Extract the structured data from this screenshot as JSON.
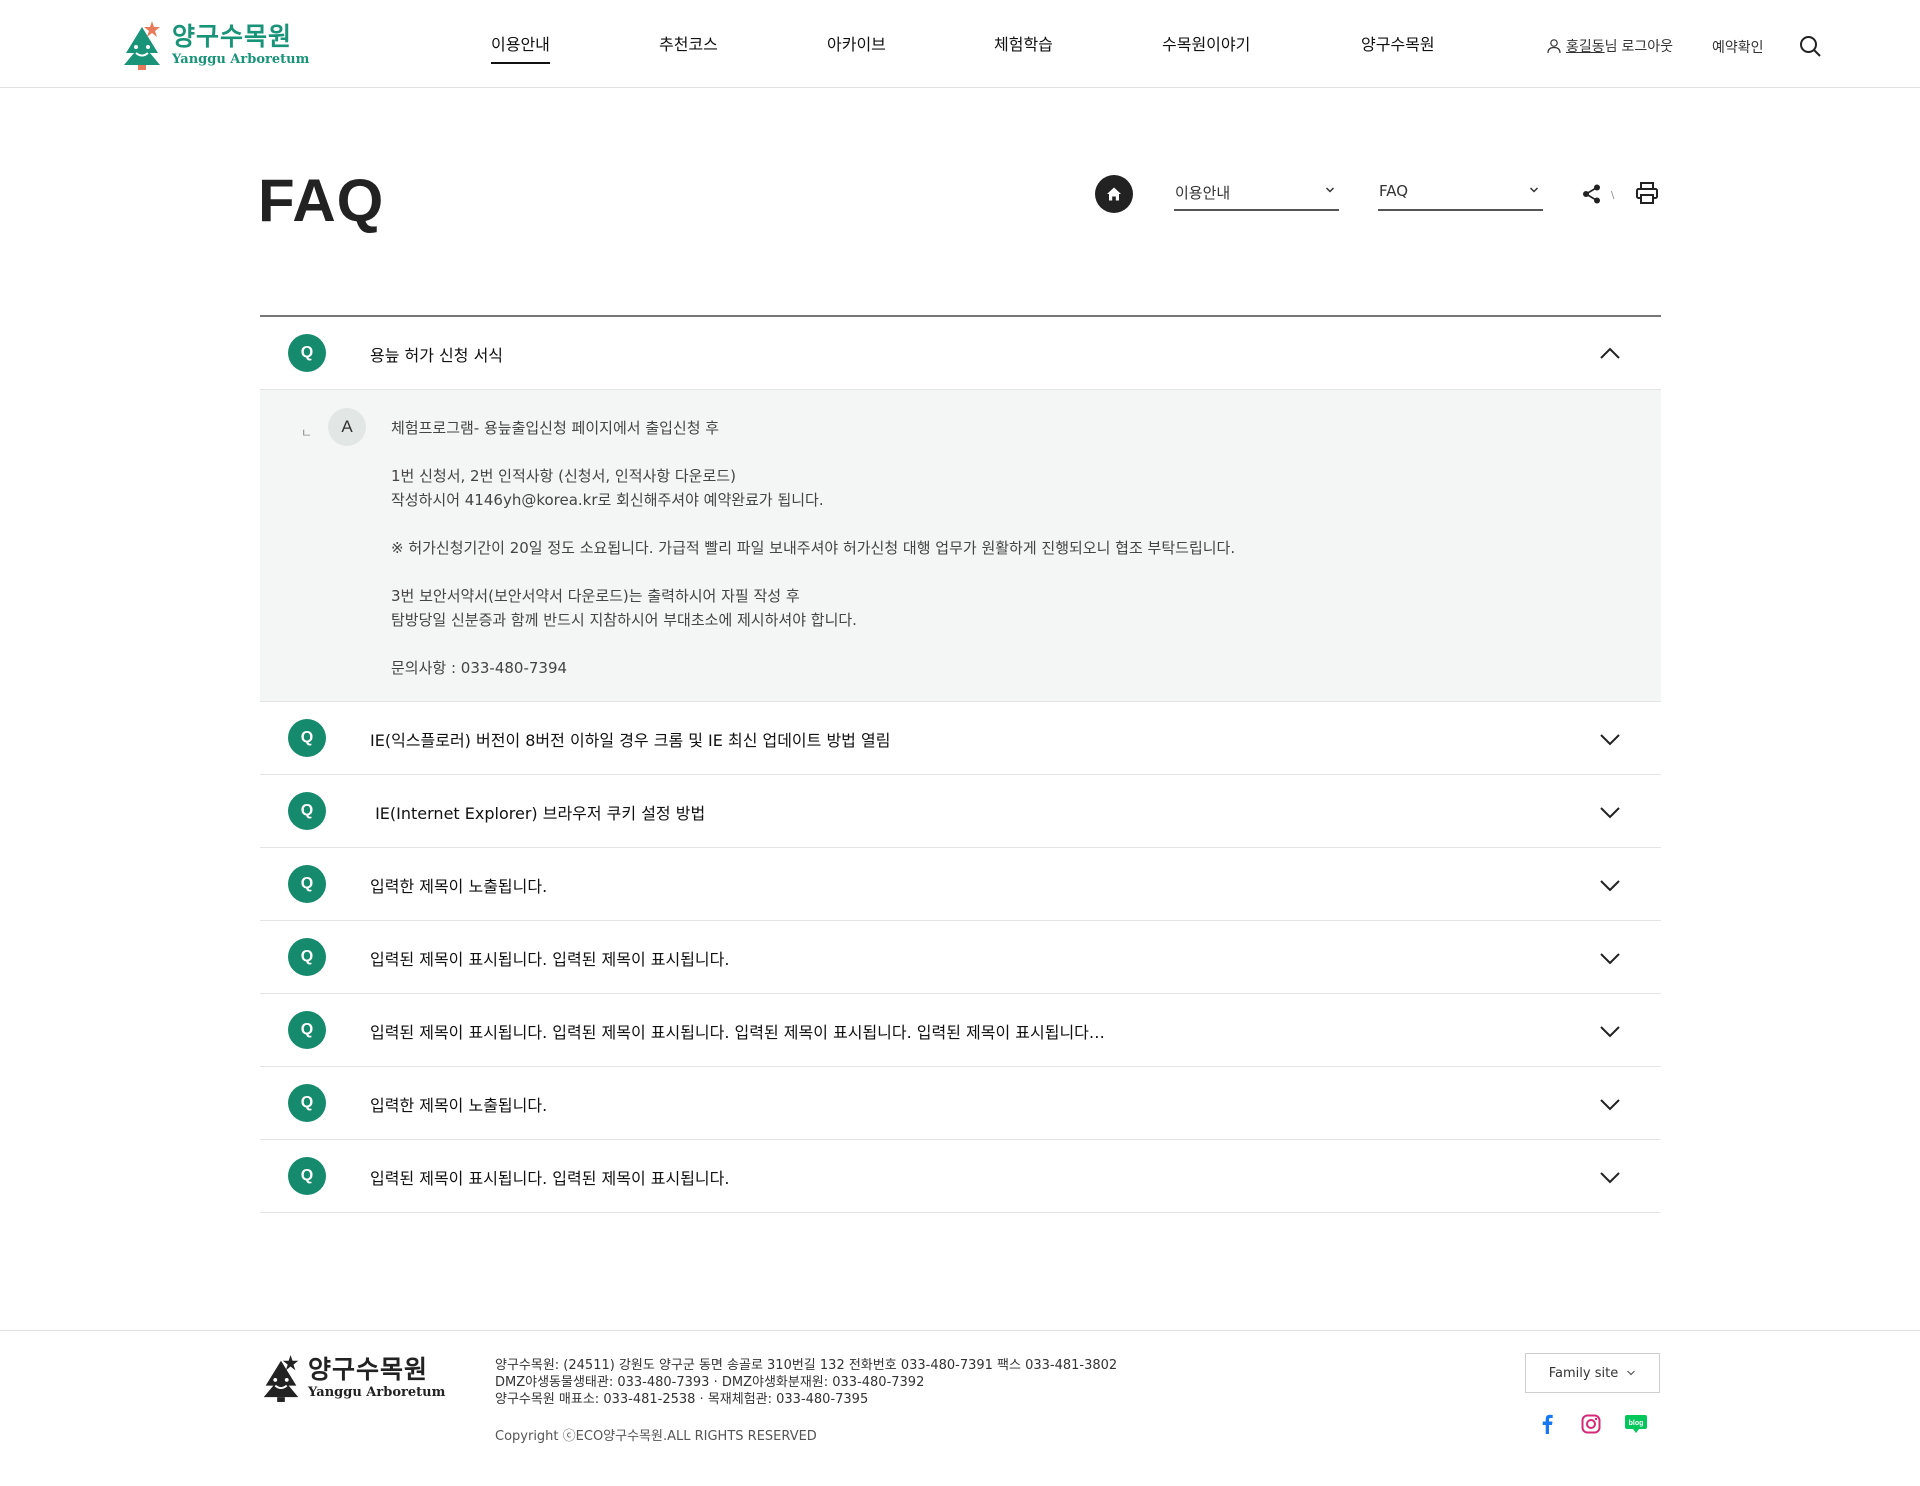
{
  "header": {
    "logo": {
      "ko": "양구수목원",
      "en": "Yanggu Arboretum"
    },
    "nav": [
      {
        "label": "이용안내",
        "active": true
      },
      {
        "label": "추천코스",
        "active": false
      },
      {
        "label": "아카이브",
        "active": false
      },
      {
        "label": "체험학습",
        "active": false
      },
      {
        "label": "수목원이야기",
        "active": false
      },
      {
        "label": "양구수목원",
        "active": false
      }
    ],
    "user": {
      "name": "홍길동",
      "suffix": "님",
      "logout": "로그아웃"
    },
    "reserve_label": "예약확인",
    "search_icon": "search-icon"
  },
  "page": {
    "title": "FAQ",
    "breadcrumb": {
      "home_icon": "home-icon",
      "depth1": "이용안내",
      "depth2": "FAQ"
    },
    "tools": {
      "share_icon": "share-icon",
      "separator": "\\",
      "print_icon": "print-icon"
    }
  },
  "faq": {
    "q_badge": "Q",
    "a_badge": "A",
    "answer_marker": "ㄴ",
    "items": [
      {
        "question": "용늪 허가 신청 서식",
        "expanded": true
      },
      {
        "question": "IE(익스플로러) 버전이 8버전 이하일 경우 크롬 및 IE 최신 업데이트 방법 열림",
        "expanded": false
      },
      {
        "question": " IE(Internet Explorer) 브라우저 쿠키 설정 방법",
        "expanded": false
      },
      {
        "question": "입력한 제목이 노출됩니다.",
        "expanded": false
      },
      {
        "question": "입력된 제목이 표시됩니다. 입력된 제목이 표시됩니다.",
        "expanded": false
      },
      {
        "question": "입력된 제목이 표시됩니다. 입력된 제목이 표시됩니다. 입력된 제목이 표시됩니다. 입력된 제목이 표시됩니다…",
        "expanded": false
      },
      {
        "question": "입력한 제목이 노출됩니다.",
        "expanded": false
      },
      {
        "question": "입력된 제목이 표시됩니다. 입력된 제목이 표시됩니다.",
        "expanded": false
      }
    ],
    "answer_lines": [
      "체험프로그램- 용늪출입신청 페이지에서 출입신청 후",
      "",
      "1번 신청서, 2번 인적사항 (신청서, 인적사항 다운로드)",
      "작성하시어 4146yh@korea.kr로 회신해주셔야 예약완료가 됩니다.",
      "",
      "※ 허가신청기간이 20일 정도 소요됩니다. 가급적 빨리 파일 보내주셔야 허가신청 대행 업무가 원활하게 진행되오니 협조 부탁드립니다.",
      "",
      "3번 보안서약서(보안서약서 다운로드)는 출력하시어 자필 작성 후",
      "탐방당일 신분증과 함께 반드시 지참하시어 부대초소에 제시하셔야 합니다.",
      "",
      "문의사항 : 033-480-7394"
    ]
  },
  "footer": {
    "logo": {
      "ko": "양구수목원",
      "en": "Yanggu Arboretum"
    },
    "info_lines": [
      "양구수목원: (24511) 강원도 양구군 동면 송골로 310번길 132 전화번호 033-480-7391 팩스 033-481-3802",
      "DMZ야생동물생태관: 033-480-7393 · DMZ야생화분재원: 033-480-7392",
      "양구수목원 매표소: 033-481-2538 · 목재체험관: 033-480-7395"
    ],
    "copyright": "Copyright ⓒECO양구수목원.ALL RIGHTS RESERVED",
    "family_site": "Family site",
    "sns": [
      {
        "icon": "facebook-icon",
        "color": "#1877f2"
      },
      {
        "icon": "instagram-icon",
        "color": "#d62976"
      },
      {
        "icon": "blog-icon",
        "color": "#03c75a",
        "label": "blog"
      }
    ]
  },
  "colors": {
    "accent": "#168a6c",
    "logo_green": "#1a9479",
    "answer_bg": "#f3f6f5"
  }
}
